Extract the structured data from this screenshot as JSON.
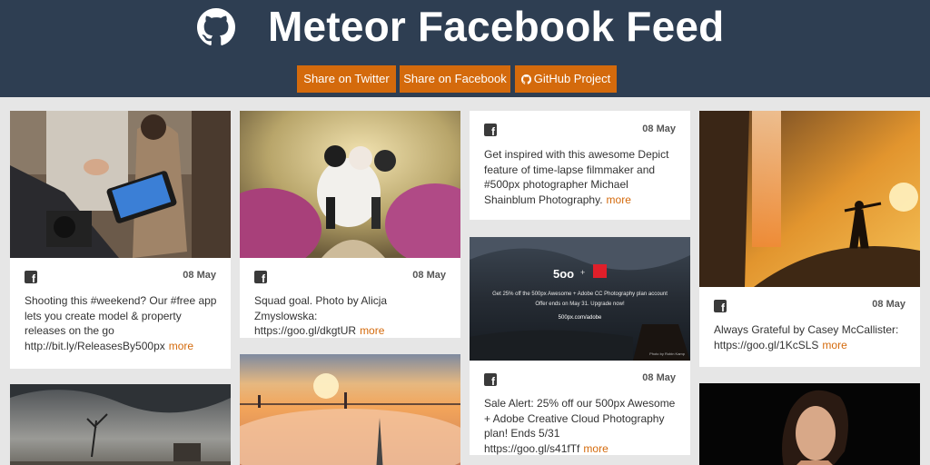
{
  "header": {
    "title": "Meteor Facebook Feed",
    "buttons": {
      "twitter": "Share on Twitter",
      "facebook": "Share on Facebook",
      "github": "GitHub Project"
    }
  },
  "colors": {
    "header_bg": "#2e3e52",
    "accent": "#d46a0c",
    "page_bg": "#e6e6e6"
  },
  "posts": [
    {
      "date": "08 May",
      "text": "Shooting this #weekend? Our #free app lets you create model & property releases on the go http://bit.ly/ReleasesBy500px",
      "more": "more"
    },
    {
      "date": "08 May",
      "text": "Squad goal. Photo by Alicja Zmyslowska: https://goo.gl/dkgtUR",
      "more": "more"
    },
    {
      "date": "08 May",
      "text": "Get inspired with this awesome Depict feature of time-lapse filmmaker and #500px photographer Michael Shainblum Photography.",
      "more": "more"
    },
    {
      "date": "08 May",
      "text": "Sale Alert: 25% off our 500px Awesome + Adobe Creative Cloud Photography plan! Ends 5/31 https://goo.gl/s41fTf",
      "more": "more"
    },
    {
      "date": "08 May",
      "text": "Always Grateful by Casey McCallister: https://goo.gl/1KcSLS",
      "more": "more"
    }
  ],
  "ad_image": {
    "logo_text": "5oo",
    "plus": "+",
    "line1": "Get 25% off the 500px Awesome + Adobe CC Photography plan account",
    "line2": "Offer ends on May 31. Upgrade now!",
    "url": "500px.com/adobe",
    "credit": "Photo by Robin Kamp"
  },
  "icons": {
    "facebook": "facebook-square-icon",
    "github": "github-icon"
  }
}
